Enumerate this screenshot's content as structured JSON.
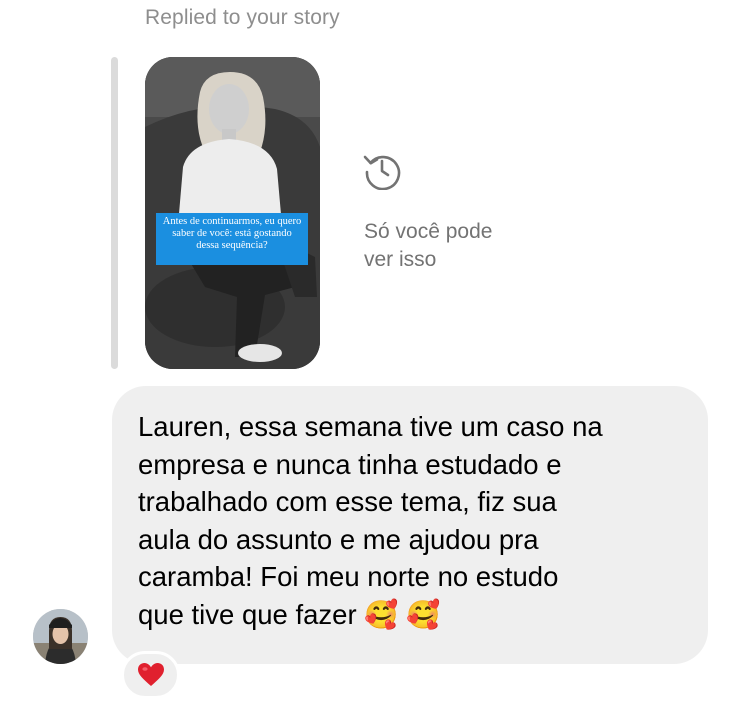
{
  "reply_header": {
    "text": "Replied to your story"
  },
  "story": {
    "caption": "Antes de continuarmos, eu quero saber de você: está gostando dessa sequência?"
  },
  "story_notice": {
    "icon": "history-icon",
    "text": "Só você pode\nver isso"
  },
  "message": {
    "text": "Lauren, essa semana tive um caso na\nempresa e nunca tinha estudado e\ntrabalhado com esse tema, fiz sua\naula do assunto e me ajudou pra\ncaramba! Foi meu norte no estudo\nque tive que fazer 🥰 🥰",
    "reaction": "❤️",
    "avatar_icon": "user-avatar"
  },
  "colors": {
    "bubble_background": "#efefef",
    "caption_background": "#1b8fe0",
    "reaction_heart": "#e0202e",
    "secondary_text": "#737373"
  }
}
